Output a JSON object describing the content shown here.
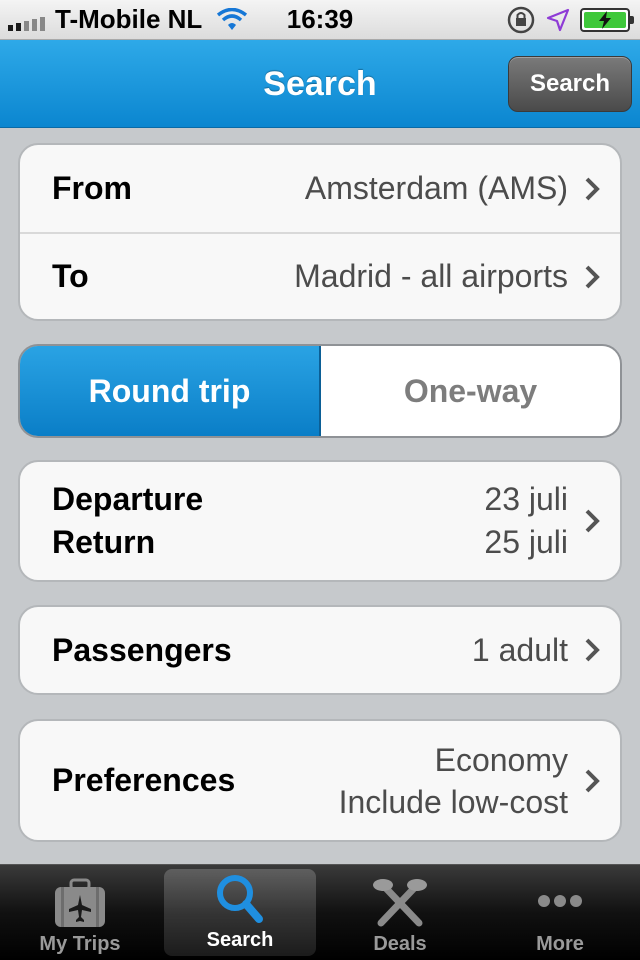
{
  "status_bar": {
    "carrier": "T-Mobile NL",
    "time": "16:39"
  },
  "nav": {
    "title": "Search",
    "search_button": "Search"
  },
  "route": {
    "from_label": "From",
    "from_value": "Amsterdam (AMS)",
    "to_label": "To",
    "to_value": "Madrid - all airports"
  },
  "trip_type": {
    "round_trip": "Round trip",
    "one_way": "One-way",
    "selected": "Round trip"
  },
  "dates": {
    "departure_label": "Departure",
    "return_label": "Return",
    "departure_value": "23 juli",
    "return_value": "25 juli"
  },
  "passengers": {
    "label": "Passengers",
    "value": "1 adult"
  },
  "preferences": {
    "label": "Preferences",
    "value_line1": "Economy",
    "value_line2": "Include low-cost"
  },
  "tabs": [
    {
      "label": "My Trips",
      "icon": "suitcase-plane-icon"
    },
    {
      "label": "Search",
      "icon": "magnifier-icon"
    },
    {
      "label": "Deals",
      "icon": "deals-icon"
    },
    {
      "label": "More",
      "icon": "more-dots-icon"
    }
  ],
  "colors": {
    "accent": "#0b86d0",
    "background": "#c6c9cc"
  }
}
